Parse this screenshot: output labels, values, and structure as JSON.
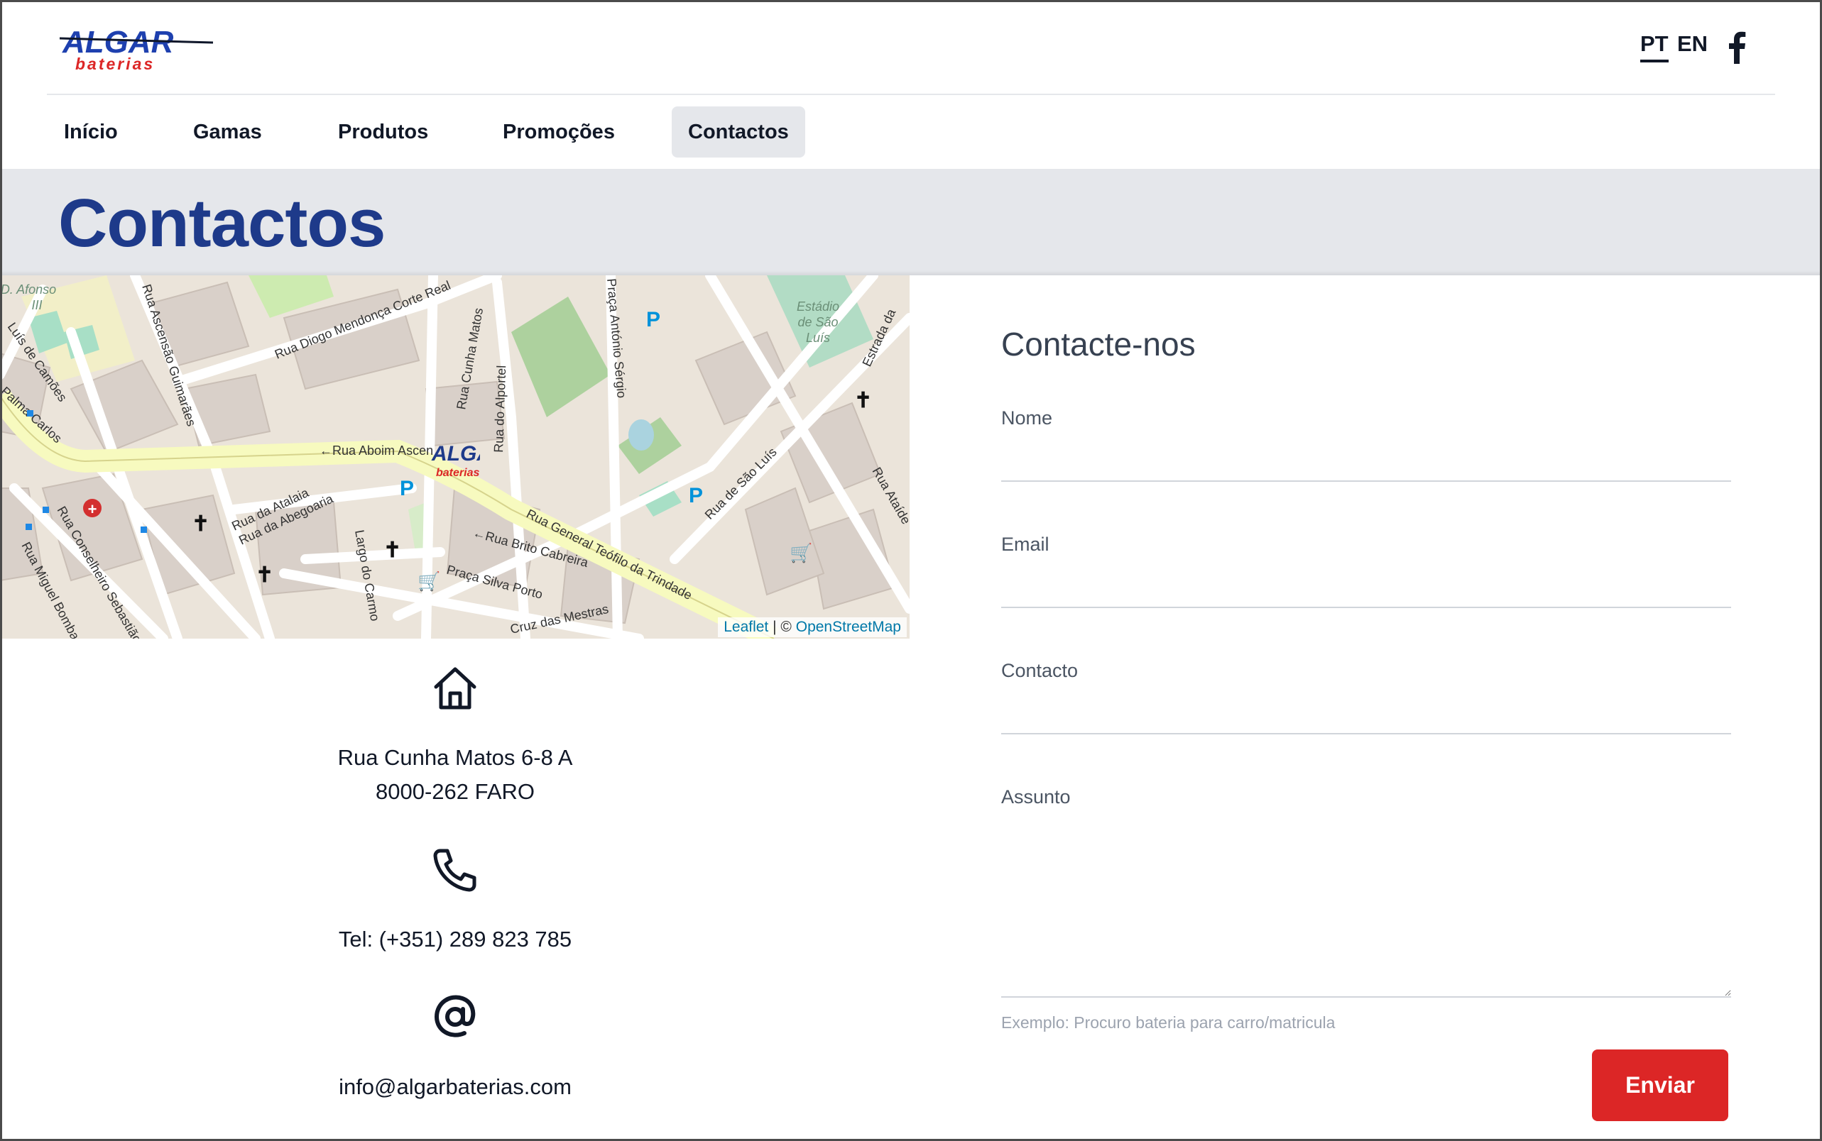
{
  "header": {
    "logo_text": "ALGAR",
    "logo_subtext": "baterias",
    "languages": [
      "PT",
      "EN"
    ],
    "nav": [
      "Início",
      "Gamas",
      "Produtos",
      "Promoções",
      "Contactos"
    ],
    "active_nav": "Contactos"
  },
  "page": {
    "title": "Contactos"
  },
  "map": {
    "streets": [
      "Rua Aboim Ascen",
      "Rua General Teófilo da Trindade",
      "Rua Brito Cabreira",
      "Rua Cunha Matos",
      "Rua do Alportel",
      "Rua Diogo Mendonça Corte Real",
      "Rua Ascensão Guimarães",
      "Rua da Atalaia",
      "Rua da Abegoaria",
      "Praça Silva Porto",
      "Rua de São Luís",
      "Rua Conselheiro Sebastião",
      "Rua Miguel Bombarda",
      "Largo do Carmo",
      "Cruz das Mestras",
      "Praça António Sérgio",
      "Estrada da",
      "Rua Ataíde"
    ],
    "places": [
      "Estádio de São Luís",
      "Escola D. Afonso III"
    ],
    "marker_text": "ALGAR",
    "marker_subtext": "baterias",
    "attribution_leaflet": "Leaflet",
    "attribution_sep": "| ©",
    "attribution_osm": "OpenStreetMap"
  },
  "contact": {
    "address_line1": "Rua Cunha Matos 6-8 A",
    "address_line2": "8000-262 FARO",
    "phone": "Tel: (+351) 289 823 785",
    "email": "info@algarbaterias.com"
  },
  "form": {
    "title": "Contacte-nos",
    "name_label": "Nome",
    "email_label": "Email",
    "contact_label": "Contacto",
    "subject_label": "Assunto",
    "helper": "Exemplo: Procuro bateria para carro/matricula",
    "submit": "Enviar"
  },
  "colors": {
    "brand_blue": "#1e3a8a",
    "button_red": "#dc2626",
    "band_gray": "#e5e7eb"
  }
}
